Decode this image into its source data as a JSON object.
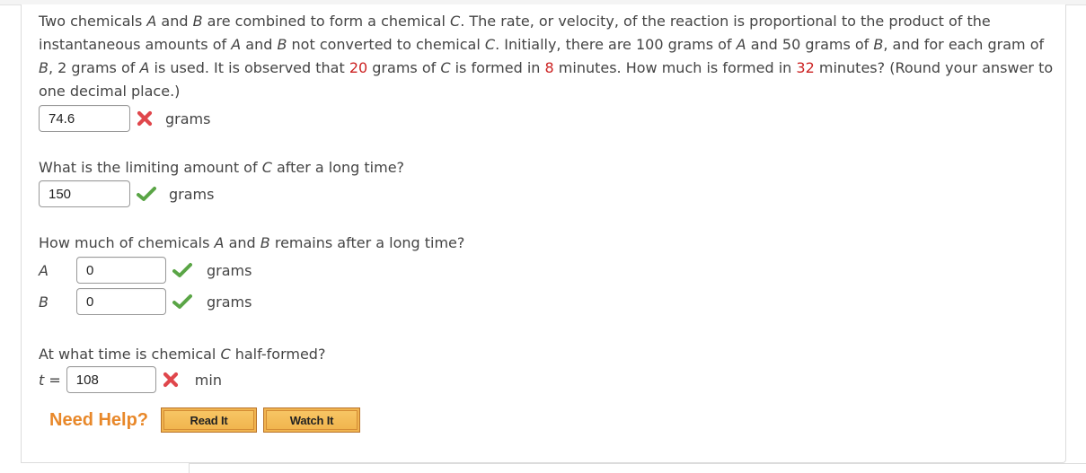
{
  "question": {
    "parts": [
      {
        "t": "Two chemicals "
      },
      {
        "t": "A",
        "style": "var"
      },
      {
        "t": " and "
      },
      {
        "t": "B",
        "style": "var"
      },
      {
        "t": " are combined to form a chemical "
      },
      {
        "t": "C",
        "style": "var"
      },
      {
        "t": ". The rate, or velocity, of the reaction is proportional to the product of the instantaneous amounts of "
      },
      {
        "t": "A",
        "style": "var"
      },
      {
        "t": " and "
      },
      {
        "t": "B",
        "style": "var"
      },
      {
        "t": " not converted to chemical "
      },
      {
        "t": "C",
        "style": "var"
      },
      {
        "t": ". Initially, there are 100 grams of "
      },
      {
        "t": "A",
        "style": "var"
      },
      {
        "t": " and 50 grams of "
      },
      {
        "t": "B",
        "style": "var"
      },
      {
        "t": ", and for each gram of "
      },
      {
        "t": "B",
        "style": "var"
      },
      {
        "t": ", 2 grams of "
      },
      {
        "t": "A",
        "style": "var"
      },
      {
        "t": " is used. It is observed that "
      },
      {
        "t": "20",
        "style": "hl"
      },
      {
        "t": " grams of "
      },
      {
        "t": "C",
        "style": "var"
      },
      {
        "t": " is formed in "
      },
      {
        "t": "8",
        "style": "hl"
      },
      {
        "t": " minutes. How much is formed in "
      },
      {
        "t": "32",
        "style": "hl"
      },
      {
        "t": " minutes? (Round your answer to one decimal place.)"
      }
    ]
  },
  "answer1": {
    "value": "74.6",
    "status": "incorrect",
    "unit": "grams"
  },
  "prompt2": {
    "before": "What is the limiting amount of ",
    "var": "C",
    "after": " after a long time?"
  },
  "answer2": {
    "value": "150",
    "status": "correct",
    "unit": "grams"
  },
  "prompt3": {
    "p1": "How much of chemicals ",
    "v1": "A",
    "p2": " and ",
    "v2": "B",
    "p3": " remains after a long time?"
  },
  "answer3a": {
    "label": "A",
    "value": "0",
    "status": "correct",
    "unit": "grams"
  },
  "answer3b": {
    "label": "B",
    "value": "0",
    "status": "correct",
    "unit": "grams"
  },
  "prompt4": {
    "before": "At what time is chemical ",
    "var": "C",
    "after": " half-formed?"
  },
  "answer4": {
    "label_var": "t",
    "label_eq": " =",
    "value": "108",
    "status": "incorrect",
    "unit": "min"
  },
  "help": {
    "label": "Need Help?",
    "read_it": "Read It",
    "watch_it": "Watch It"
  },
  "icons": {
    "incorrect": "x-mark-icon",
    "correct": "check-mark-icon"
  },
  "colors": {
    "highlight": "#cc2222",
    "incorrect": "#e0474c",
    "correct": "#5aa546",
    "help_accent": "#e8882a",
    "help_button": "#f0b450"
  }
}
